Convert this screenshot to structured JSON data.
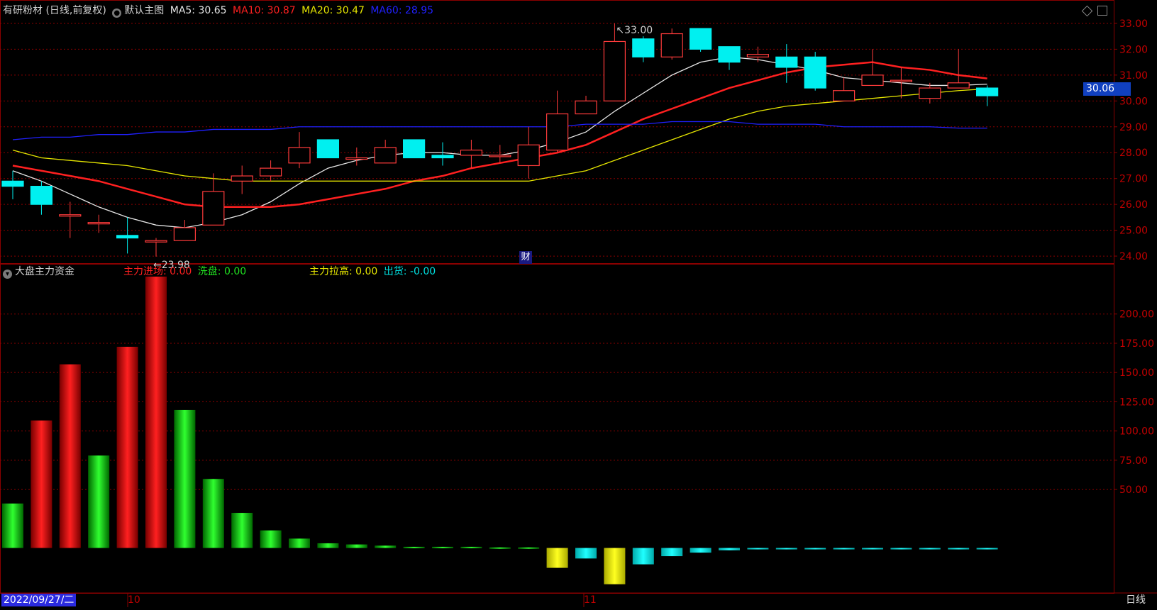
{
  "header": {
    "stock": "有研粉材 (日线,前复权)",
    "template": "默认主图",
    "ma5_label": "MA5: 30.65",
    "ma10_label": "MA10: 30.87",
    "ma20_label": "MA20: 30.47",
    "ma60_label": "MA60: 28.95"
  },
  "indicator": {
    "name": "大盘主力资金",
    "entry_label": "主力进场: 0.00",
    "wash_label": "洗盘: 0.00",
    "pull_label": "主力拉高: 0.00",
    "ship_label": "出货: -0.00"
  },
  "current_price": "30.06",
  "footer": {
    "date": "2022/09/27/二",
    "period": "日线",
    "month_oct": "10",
    "month_nov": "11"
  },
  "marker_cai": "财",
  "colors": {
    "up": "#ff3b3b",
    "down": "#00f0f0",
    "ma5": "#e6e6e6",
    "ma10": "#ff2020",
    "ma20": "#e6e600",
    "ma60": "#2020ff",
    "grid": "#8b0000"
  },
  "chart_data": [
    {
      "type": "candlestick",
      "y_ticks": [
        "33.00",
        "32.00",
        "31.00",
        "30.00",
        "29.00",
        "28.00",
        "27.00",
        "26.00",
        "25.00",
        "24.00"
      ],
      "ylim": [
        23.7,
        33.3
      ],
      "high_label": "33.00",
      "low_label": "23.98",
      "candles": [
        {
          "o": 26.9,
          "h": 27.3,
          "l": 26.2,
          "c": 26.7
        },
        {
          "o": 26.7,
          "h": 26.9,
          "l": 25.6,
          "c": 26.0
        },
        {
          "o": 25.6,
          "h": 26.1,
          "l": 24.7,
          "c": 25.6
        },
        {
          "o": 25.3,
          "h": 25.6,
          "l": 24.9,
          "c": 25.3
        },
        {
          "o": 24.8,
          "h": 25.5,
          "l": 24.1,
          "c": 24.7
        },
        {
          "o": 24.6,
          "h": 24.7,
          "l": 23.98,
          "c": 24.6
        },
        {
          "o": 24.6,
          "h": 25.4,
          "l": 24.6,
          "c": 25.1
        },
        {
          "o": 25.2,
          "h": 27.2,
          "l": 25.2,
          "c": 26.5
        },
        {
          "o": 26.9,
          "h": 27.5,
          "l": 26.4,
          "c": 27.1
        },
        {
          "o": 27.1,
          "h": 27.7,
          "l": 26.9,
          "c": 27.4
        },
        {
          "o": 27.6,
          "h": 28.8,
          "l": 27.4,
          "c": 28.2
        },
        {
          "o": 28.5,
          "h": 28.5,
          "l": 27.8,
          "c": 27.8
        },
        {
          "o": 27.8,
          "h": 28.2,
          "l": 27.5,
          "c": 27.8
        },
        {
          "o": 27.6,
          "h": 28.5,
          "l": 27.6,
          "c": 28.2
        },
        {
          "o": 28.5,
          "h": 28.5,
          "l": 27.9,
          "c": 27.8
        },
        {
          "o": 27.9,
          "h": 28.4,
          "l": 27.5,
          "c": 27.8
        },
        {
          "o": 27.9,
          "h": 28.5,
          "l": 27.4,
          "c": 28.1
        },
        {
          "o": 27.9,
          "h": 28.3,
          "l": 27.6,
          "c": 27.9
        },
        {
          "o": 27.5,
          "h": 29.0,
          "l": 27.0,
          "c": 28.3
        },
        {
          "o": 28.1,
          "h": 30.4,
          "l": 28.0,
          "c": 29.5
        },
        {
          "o": 29.5,
          "h": 30.2,
          "l": 29.5,
          "c": 30.0
        },
        {
          "o": 30.0,
          "h": 33.0,
          "l": 30.0,
          "c": 32.3
        },
        {
          "o": 32.4,
          "h": 32.5,
          "l": 31.5,
          "c": 31.7
        },
        {
          "o": 31.7,
          "h": 32.8,
          "l": 31.6,
          "c": 32.6
        },
        {
          "o": 32.8,
          "h": 32.8,
          "l": 31.9,
          "c": 32.0
        },
        {
          "o": 32.1,
          "h": 32.1,
          "l": 31.2,
          "c": 31.5
        },
        {
          "o": 31.7,
          "h": 32.1,
          "l": 31.5,
          "c": 31.8
        },
        {
          "o": 31.7,
          "h": 32.2,
          "l": 30.7,
          "c": 31.3
        },
        {
          "o": 31.7,
          "h": 31.9,
          "l": 30.4,
          "c": 30.5
        },
        {
          "o": 30.0,
          "h": 30.9,
          "l": 30.0,
          "c": 30.4
        },
        {
          "o": 30.6,
          "h": 32.0,
          "l": 30.6,
          "c": 31.0
        },
        {
          "o": 30.8,
          "h": 31.3,
          "l": 30.1,
          "c": 30.8
        },
        {
          "o": 30.1,
          "h": 30.7,
          "l": 29.9,
          "c": 30.5
        },
        {
          "o": 30.5,
          "h": 32.0,
          "l": 30.5,
          "c": 30.7
        },
        {
          "o": 30.5,
          "h": 30.6,
          "l": 29.8,
          "c": 30.2
        }
      ],
      "ma_lines": [
        {
          "name": "MA5",
          "color": "#e6e6e6",
          "values": [
            27.3,
            26.9,
            26.4,
            25.9,
            25.5,
            25.2,
            25.1,
            25.3,
            25.6,
            26.1,
            26.8,
            27.4,
            27.7,
            27.9,
            28.0,
            28.0,
            27.9,
            27.9,
            28.1,
            28.4,
            28.8,
            29.6,
            30.3,
            31.0,
            31.5,
            31.7,
            31.6,
            31.4,
            31.2,
            30.9,
            30.8,
            30.7,
            30.6,
            30.6,
            30.65
          ]
        },
        {
          "name": "MA10",
          "color": "#ff2020",
          "values": [
            27.5,
            27.3,
            27.1,
            26.9,
            26.6,
            26.3,
            26.0,
            25.9,
            25.9,
            25.9,
            26.0,
            26.2,
            26.4,
            26.6,
            26.9,
            27.1,
            27.4,
            27.6,
            27.8,
            28.0,
            28.3,
            28.8,
            29.3,
            29.7,
            30.1,
            30.5,
            30.8,
            31.1,
            31.3,
            31.4,
            31.5,
            31.3,
            31.2,
            31.0,
            30.87
          ]
        },
        {
          "name": "MA20",
          "color": "#e6e600",
          "values": [
            28.1,
            27.8,
            27.7,
            27.6,
            27.5,
            27.3,
            27.1,
            27.0,
            26.9,
            26.9,
            26.9,
            26.9,
            26.9,
            26.9,
            26.9,
            26.9,
            26.9,
            26.9,
            26.9,
            27.1,
            27.3,
            27.7,
            28.1,
            28.5,
            28.9,
            29.3,
            29.6,
            29.8,
            29.9,
            30.0,
            30.1,
            30.2,
            30.3,
            30.4,
            30.47
          ]
        },
        {
          "name": "MA60",
          "color": "#2020ff",
          "values": [
            28.5,
            28.6,
            28.6,
            28.7,
            28.7,
            28.8,
            28.8,
            28.9,
            28.9,
            28.9,
            29.0,
            29.0,
            29.0,
            29.0,
            29.0,
            29.0,
            29.0,
            29.0,
            29.0,
            29.0,
            29.1,
            29.1,
            29.1,
            29.2,
            29.2,
            29.2,
            29.1,
            29.1,
            29.1,
            29.0,
            29.0,
            29.0,
            29.0,
            28.95,
            28.95
          ]
        }
      ]
    },
    {
      "type": "bar",
      "y_ticks": [
        "200.00",
        "175.00",
        "150.00",
        "125.00",
        "100.00",
        "75.00",
        "50.00"
      ],
      "ylim": [
        -30,
        235
      ],
      "values": [
        38,
        109,
        157,
        79,
        172,
        232,
        118,
        59,
        30,
        15,
        8,
        4,
        3,
        2,
        1,
        1,
        1,
        0.5,
        0.5,
        -17,
        -9,
        -31,
        -14,
        -7,
        -4,
        -2,
        -1,
        -1,
        -1,
        -1,
        -1,
        -1,
        -1,
        -1,
        -1
      ],
      "bar_colors": [
        "g",
        "r",
        "r",
        "g",
        "r",
        "r",
        "g",
        "g",
        "g",
        "g",
        "g",
        "g",
        "g",
        "g",
        "g",
        "g",
        "g",
        "g",
        "g",
        "y",
        "c",
        "y",
        "c",
        "c",
        "c",
        "c",
        "c",
        "c",
        "c",
        "c",
        "c",
        "c",
        "c",
        "c",
        "c"
      ]
    }
  ]
}
